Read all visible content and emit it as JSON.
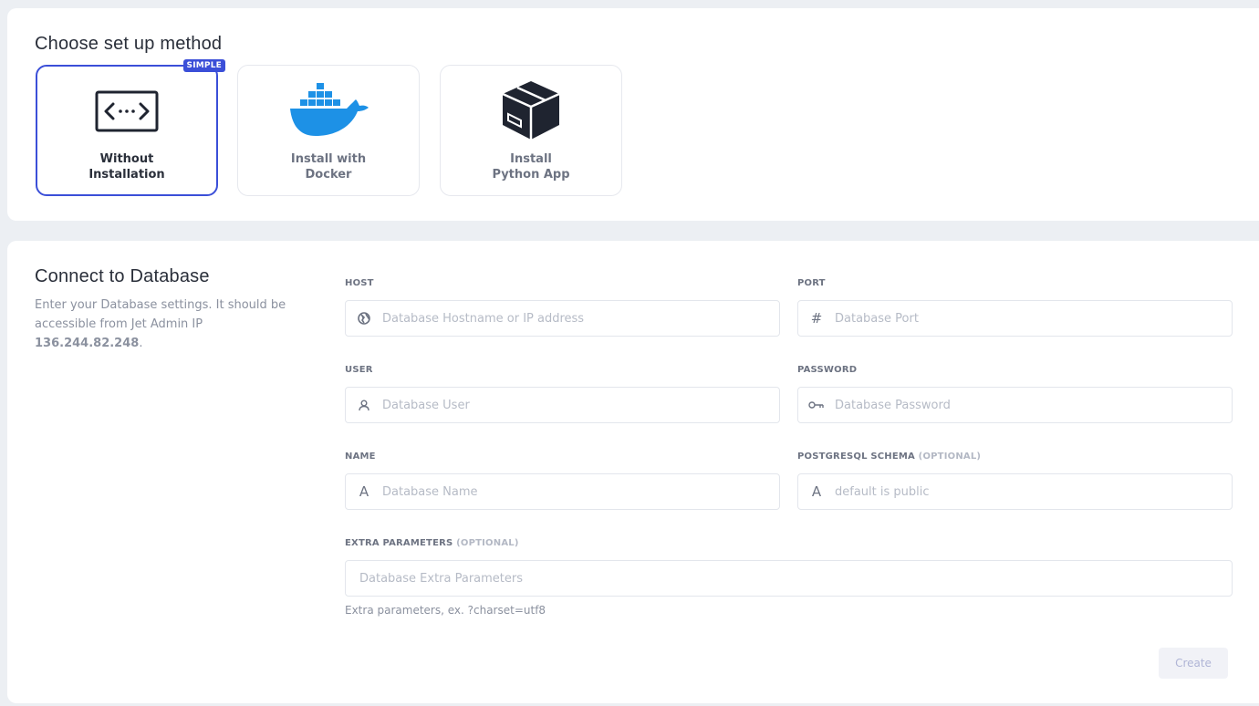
{
  "setup": {
    "title": "Choose set up method",
    "methods": [
      {
        "label": "Without\nInstallation",
        "badge": "SIMPLE",
        "icon": "code-window-icon",
        "selected": true
      },
      {
        "label": "Install with\nDocker",
        "icon": "docker-whale-icon",
        "selected": false
      },
      {
        "label": "Install\nPython App",
        "icon": "package-box-icon",
        "selected": false
      }
    ]
  },
  "database": {
    "title": "Connect to Database",
    "description_prefix": "Enter your Database settings. It should be accessible from Jet Admin IP ",
    "ip": "136.244.82.248",
    "description_suffix": ".",
    "fields": {
      "host": {
        "label": "HOST",
        "placeholder": "Database Hostname or IP address",
        "icon": "globe-icon"
      },
      "port": {
        "label": "PORT",
        "placeholder": "Database Port",
        "icon": "hash-icon"
      },
      "user": {
        "label": "USER",
        "placeholder": "Database User",
        "icon": "user-icon"
      },
      "password": {
        "label": "PASSWORD",
        "placeholder": "Database Password",
        "icon": "key-icon"
      },
      "name": {
        "label": "NAME",
        "placeholder": "Database Name",
        "icon": "text-a-icon"
      },
      "schema": {
        "label": "POSTGRESQL SCHEMA",
        "optional": "(OPTIONAL)",
        "placeholder": "default is public",
        "icon": "text-a-icon"
      },
      "extra": {
        "label": "EXTRA PARAMETERS",
        "optional": "(OPTIONAL)",
        "placeholder": "Database Extra Parameters",
        "hint": "Extra parameters, ex. ?charset=utf8"
      }
    },
    "create_label": "Create"
  },
  "colors": {
    "accent": "#3b4fd8",
    "docker_blue": "#1d91e6",
    "background": "#eceff3"
  }
}
